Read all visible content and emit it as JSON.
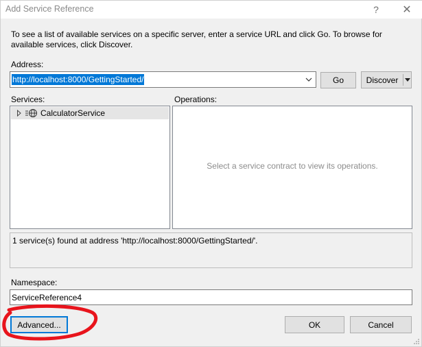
{
  "window": {
    "title": "Add Service Reference",
    "help_label": "?",
    "close_label": "✕"
  },
  "intro": {
    "text": "To see a list of available services on a specific server, enter a service URL and click Go. To browse for available services, click Discover."
  },
  "address": {
    "label": "Address:",
    "value": "http://localhost:8000/GettingStarted/"
  },
  "buttons": {
    "go": "Go",
    "discover": "Discover",
    "advanced": "Advanced...",
    "ok": "OK",
    "cancel": "Cancel"
  },
  "services": {
    "label": "Services:",
    "items": [
      {
        "label": "CalculatorService"
      }
    ]
  },
  "operations": {
    "label": "Operations:",
    "placeholder": "Select a service contract to view its operations."
  },
  "status": {
    "text": "1 service(s) found at address 'http://localhost:8000/GettingStarted/'."
  },
  "namespace": {
    "label": "Namespace:",
    "value": "ServiceReference4"
  },
  "colors": {
    "selection": "#0078d7",
    "annotation": "#e8141c"
  }
}
